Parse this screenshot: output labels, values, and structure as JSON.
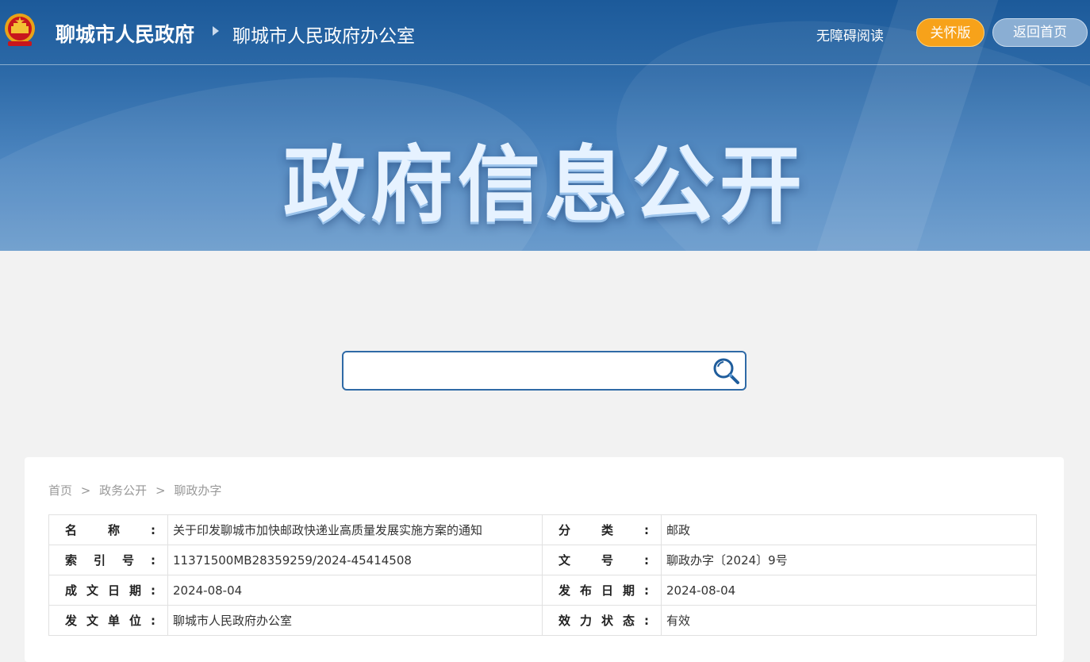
{
  "header": {
    "site_name": "聊城市人民政府",
    "office_name": "聊城市人民政府办公室",
    "accessibility_label": "无障碍阅读",
    "care_version_label": "关怀版",
    "home_label": "返回首页"
  },
  "banner": {
    "title": "政府信息公开"
  },
  "search": {
    "value": "",
    "placeholder": ""
  },
  "breadcrumb": {
    "home": "首页",
    "level2": "政务公开",
    "level3": "聊政办字",
    "separator": ">"
  },
  "info": {
    "name_label": "名称:",
    "name_value": "关于印发聊城市加快邮政快递业高质量发展实施方案的通知",
    "category_label": "分类:",
    "category_value": "邮政",
    "index_label": "索引号:",
    "index_value": "11371500MB28359259/2024-45414508",
    "doc_no_label": "文号:",
    "doc_no_value": "聊政办字〔2024〕9号",
    "created_label": "成文日期:",
    "created_value": "2024-08-04",
    "published_label": "发布日期:",
    "published_value": "2024-08-04",
    "issuer_label": "发文单位:",
    "issuer_value": "聊城市人民政府办公室",
    "status_label": "效力状态:",
    "status_value": "有效"
  },
  "colors": {
    "banner_top": "#1c5a9a",
    "banner_bottom": "#6a9bcc",
    "care_button": "#f7a21a",
    "search_border": "#2f6aa6",
    "page_background": "#f2f2f2"
  },
  "icons": {
    "emblem": "national-emblem-icon",
    "search": "search-icon"
  }
}
